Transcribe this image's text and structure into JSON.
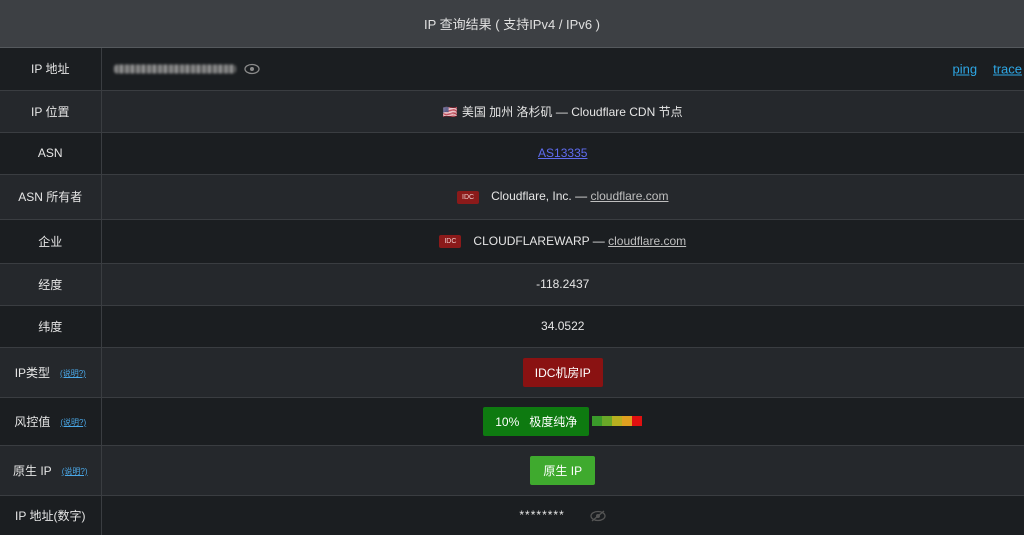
{
  "header": {
    "title": "IP 查询结果 ( 支持IPv4 / IPv6 )"
  },
  "actions": {
    "ping": "ping",
    "trace": "trace"
  },
  "rows": {
    "ip": {
      "label": "IP 地址"
    },
    "location": {
      "label": "IP 位置",
      "flag": "🇺🇸",
      "value": "美国 加州 洛杉矶 — Cloudflare CDN 节点"
    },
    "asn": {
      "label": "ASN",
      "value": "AS13335"
    },
    "asn_owner": {
      "label": "ASN 所有者",
      "tag": "IDC",
      "name": "Cloudflare, Inc. — ",
      "domain": "cloudflare.com"
    },
    "company": {
      "label": "企业",
      "tag": "IDC",
      "name": "CLOUDFLAREWARP — ",
      "domain": "cloudflare.com"
    },
    "longitude": {
      "label": "经度",
      "value": "-118.2437"
    },
    "latitude": {
      "label": "纬度",
      "value": "34.0522"
    },
    "ip_type": {
      "label": "IP类型",
      "help": "(说明?)",
      "value": "IDC机房IP"
    },
    "risk": {
      "label": "风控值",
      "help": "(说明?)",
      "value": "10%   极度纯净",
      "percent": 10
    },
    "native": {
      "label": "原生 IP",
      "help": "(说明?)",
      "value": "原生 IP"
    },
    "ip_numeric": {
      "label": "IP 地址(数字)",
      "value": "********"
    }
  },
  "colors": {
    "risk_scale": [
      "#3a9a2a",
      "#6aa828",
      "#b8b020",
      "#e0a020",
      "#e01010"
    ]
  }
}
